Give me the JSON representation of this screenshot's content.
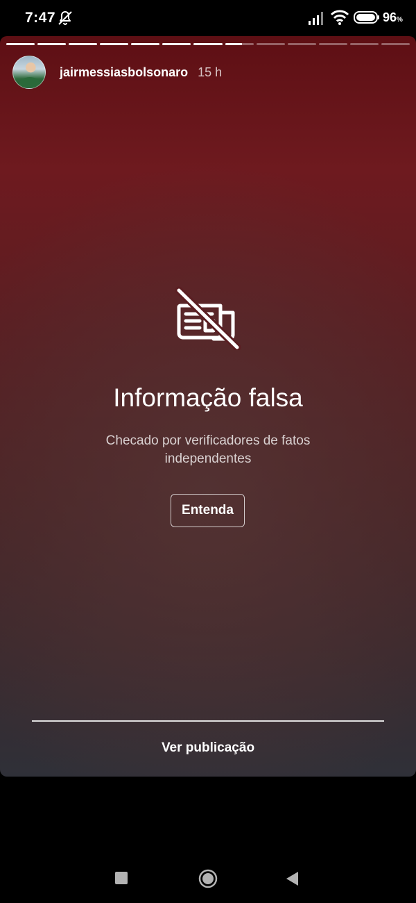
{
  "status_bar": {
    "time": "7:47",
    "battery": "96",
    "battery_unit": "%",
    "icons": [
      "bell-off-icon",
      "signal-icon",
      "wifi-icon",
      "battery-icon"
    ]
  },
  "story": {
    "progress_segments": [
      1,
      1,
      1,
      1,
      1,
      1,
      1,
      0.6,
      0,
      0,
      0,
      0,
      0
    ],
    "username": "jairmessiasbolsonaro",
    "time_ago": "15 h",
    "warning_icon": "newspaper-crossed-icon",
    "title": "Informação falsa",
    "subtitle": "Checado por verificadores de fatos independentes",
    "button_label": "Entenda",
    "footer_link": "Ver publicação"
  },
  "nav_bar": {
    "icons": [
      "recents-square-icon",
      "home-circle-icon",
      "back-triangle-icon"
    ]
  },
  "colors": {
    "story_top": "#5e0f14",
    "story_bottom": "#2f3038",
    "text": "#ffffff"
  }
}
